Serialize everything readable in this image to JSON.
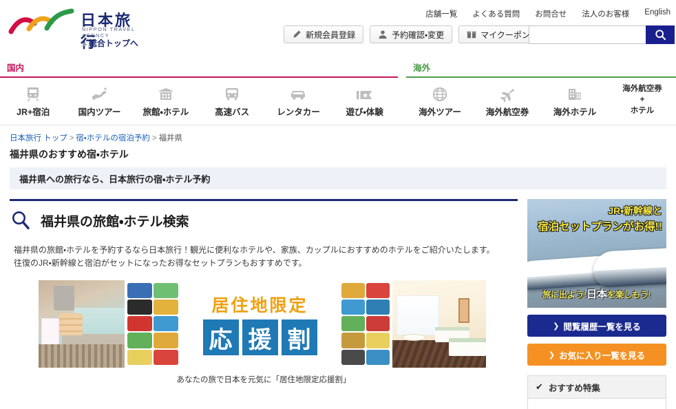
{
  "header": {
    "logo": {
      "jp": "日本旅行",
      "en": "NIPPON TRAVEL AGENCY",
      "top_link": "総合トップへ",
      "arrow": "▶"
    },
    "top_links": [
      {
        "label": "店舗一覧"
      },
      {
        "label": "よくある質問"
      },
      {
        "label": "お問合せ"
      },
      {
        "label": "法人のお客様"
      },
      {
        "label": "English"
      }
    ],
    "actions": [
      {
        "label": "新規会員登録",
        "icon": "pencil-icon"
      },
      {
        "label": "予約確認・変更",
        "icon": "person-icon"
      },
      {
        "label": "マイクーポン",
        "icon": "coupon-icon"
      }
    ],
    "search": {
      "value": "",
      "placeholder": "",
      "button_icon": "search-icon",
      "button_color": "#1a1f8f"
    }
  },
  "catnav": {
    "domestic": {
      "label": "国内",
      "color": "#c2185b",
      "items": [
        {
          "label": "JR+宿泊",
          "icon": "train-icon"
        },
        {
          "label": "国内ツアー",
          "icon": "japan-map-icon"
        },
        {
          "label": "旅館・ホテル",
          "icon": "hotel-building-icon"
        },
        {
          "label": "高速バス",
          "icon": "bus-icon"
        },
        {
          "label": "レンタカー",
          "icon": "car-icon"
        },
        {
          "label": "遊び・体験",
          "icon": "ticket-star-icon"
        }
      ]
    },
    "overseas": {
      "label": "海外",
      "color": "#4a9d4a",
      "items": [
        {
          "label": "海外ツアー",
          "icon": "globe-icon"
        },
        {
          "label": "海外航空券",
          "icon": "airplane-icon"
        },
        {
          "label": "海外ホテル",
          "icon": "office-building-icon"
        },
        {
          "label_line1": "海外航空券",
          "label_line2": "+",
          "label_line3": "ホテル",
          "icon": "none"
        }
      ]
    }
  },
  "breadcrumb": {
    "items": [
      {
        "label": "日本旅行 トップ",
        "link": true
      },
      {
        "label": "宿・ホテルの宿泊予約",
        "link": true
      },
      {
        "label": "福井県",
        "link": false
      }
    ],
    "separator": ">"
  },
  "page_title": "福井県のおすすめ宿・ホテル",
  "promo_bar": "福井県への旅行なら、日本旅行の宿・ホテル予約",
  "main": {
    "section_title": "福井県の旅館・ホテル検索",
    "section_icon": "magnifier-icon",
    "accent_color": "#1b2a72",
    "lede_line1": "福井県の旅館・ホテルを予約するなら日本旅行！観光に便利なホテルや、家族、カップルにおすすめのホテルをご紹介いたします。",
    "lede_line2": "往復のJR・新幹線と宿泊がセットになったお得なセットプランもおすすめです。",
    "campaign_banner": {
      "sub_text": "居住地限定",
      "main_chars": [
        "応",
        "援",
        "割"
      ],
      "sub_color": "#f0a013",
      "box_color": "#1f79b5",
      "left_photo": "onsen-bath-photo",
      "right_photo": "hotel-twin-room-photo",
      "caption": "あなたの旅で日本を元気に「居住地限定応援割」"
    }
  },
  "sidebar": {
    "banner": {
      "line1": "JR・新幹線と",
      "line2": "宿泊セットプランがお得!!",
      "tagline_pre": "旅",
      "tagline_mid": "に出よう!",
      "tagline_jp": "日本",
      "tagline_post": "を楽しもう!",
      "photo": "shinkansen-photo",
      "text_color": "#f5e642"
    },
    "buttons": [
      {
        "label": "閲覧履歴一覧を見る",
        "color": "#1b2a8e",
        "chevron": "❯"
      },
      {
        "label": "お気に入り一覧を見る",
        "color": "#f59123",
        "chevron": "❯"
      }
    ],
    "panel": {
      "title": "おすすめ特集",
      "check_icon": "check-icon"
    }
  }
}
